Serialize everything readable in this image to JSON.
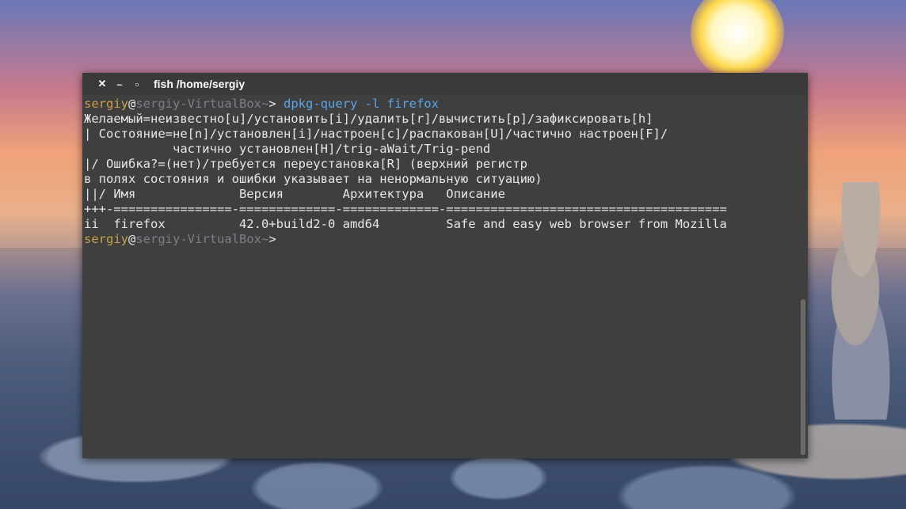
{
  "window": {
    "title": "fish  /home/sergiy",
    "close_glyph": "✕",
    "minimize_glyph": "–",
    "maximize_glyph": "▫"
  },
  "terminal": {
    "prompt": {
      "user": "sergiy",
      "at": "@",
      "host": "sergiy-VirtualBox",
      "tilde": "~",
      "symbol": "> "
    },
    "command": "dpkg-query -l firefox",
    "output": [
      "Желаемый=неизвестно[u]/установить[i]/удалить[r]/вычистить[p]/зафиксировать[h]",
      "| Состояние=не[n]/установлен[i]/настроен[c]/распакован[U]/частично настроен[F]/",
      "            частично установлен[H]/trig-aWait/Trig-pend",
      "|/ Ошибка?=(нет)/требуется переустановка[R] (верхний регистр",
      "в полях состояния и ошибки указывает на ненормальную ситуацию)",
      "||/ Имя              Версия        Архитектура   Описание",
      "+++-================-=============-=============-======================================",
      "ii  firefox          42.0+build2-0 amd64         Safe and easy web browser from Mozilla"
    ]
  }
}
